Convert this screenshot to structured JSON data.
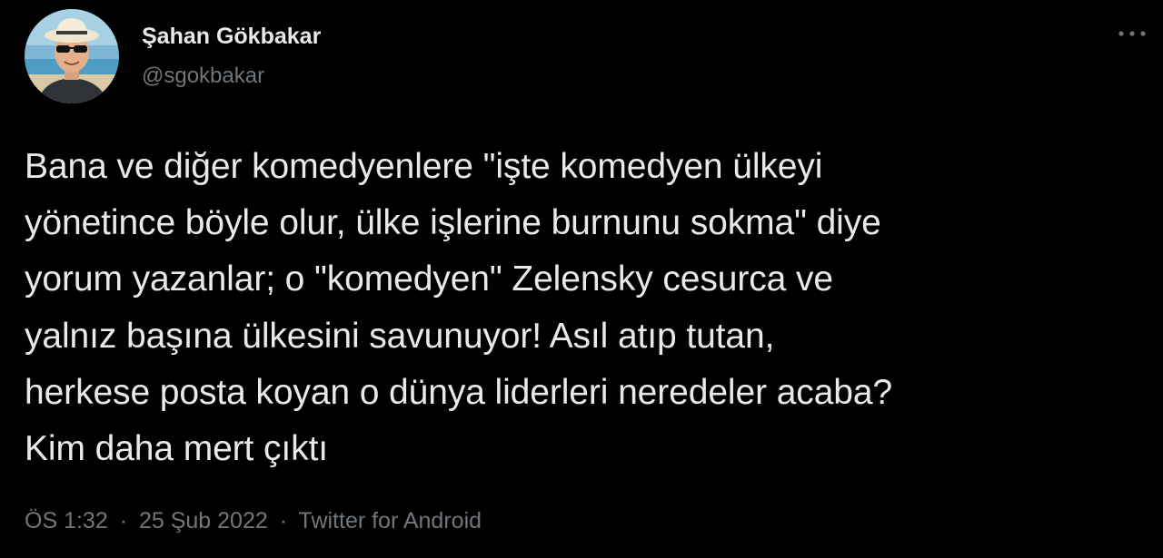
{
  "colors": {
    "background": "#000000",
    "primary_text": "#e7e9ea",
    "secondary_text": "#71767b"
  },
  "author": {
    "display_name": "Şahan Gökbakar",
    "handle": "@sgokbakar",
    "avatar_icon": "user-avatar-photo"
  },
  "more_icon": "more-horizontal-icon",
  "tweet": {
    "text": "Bana ve diğer komedyenlere \"işte komedyen ülkeyi\nyönetince böyle olur, ülke işlerine burnunu sokma\" diye\nyorum yazanlar; o \"komedyen\" Zelensky cesurca ve\nyalnız başına ülkesini savunuyor! Asıl atıp tutan,\nherkese posta koyan o dünya liderleri neredeler acaba?\nKim daha mert çıktı"
  },
  "meta": {
    "time": "ÖS 1:32",
    "separator": "·",
    "date": "25 Şub 2022",
    "source": "Twitter for Android"
  }
}
